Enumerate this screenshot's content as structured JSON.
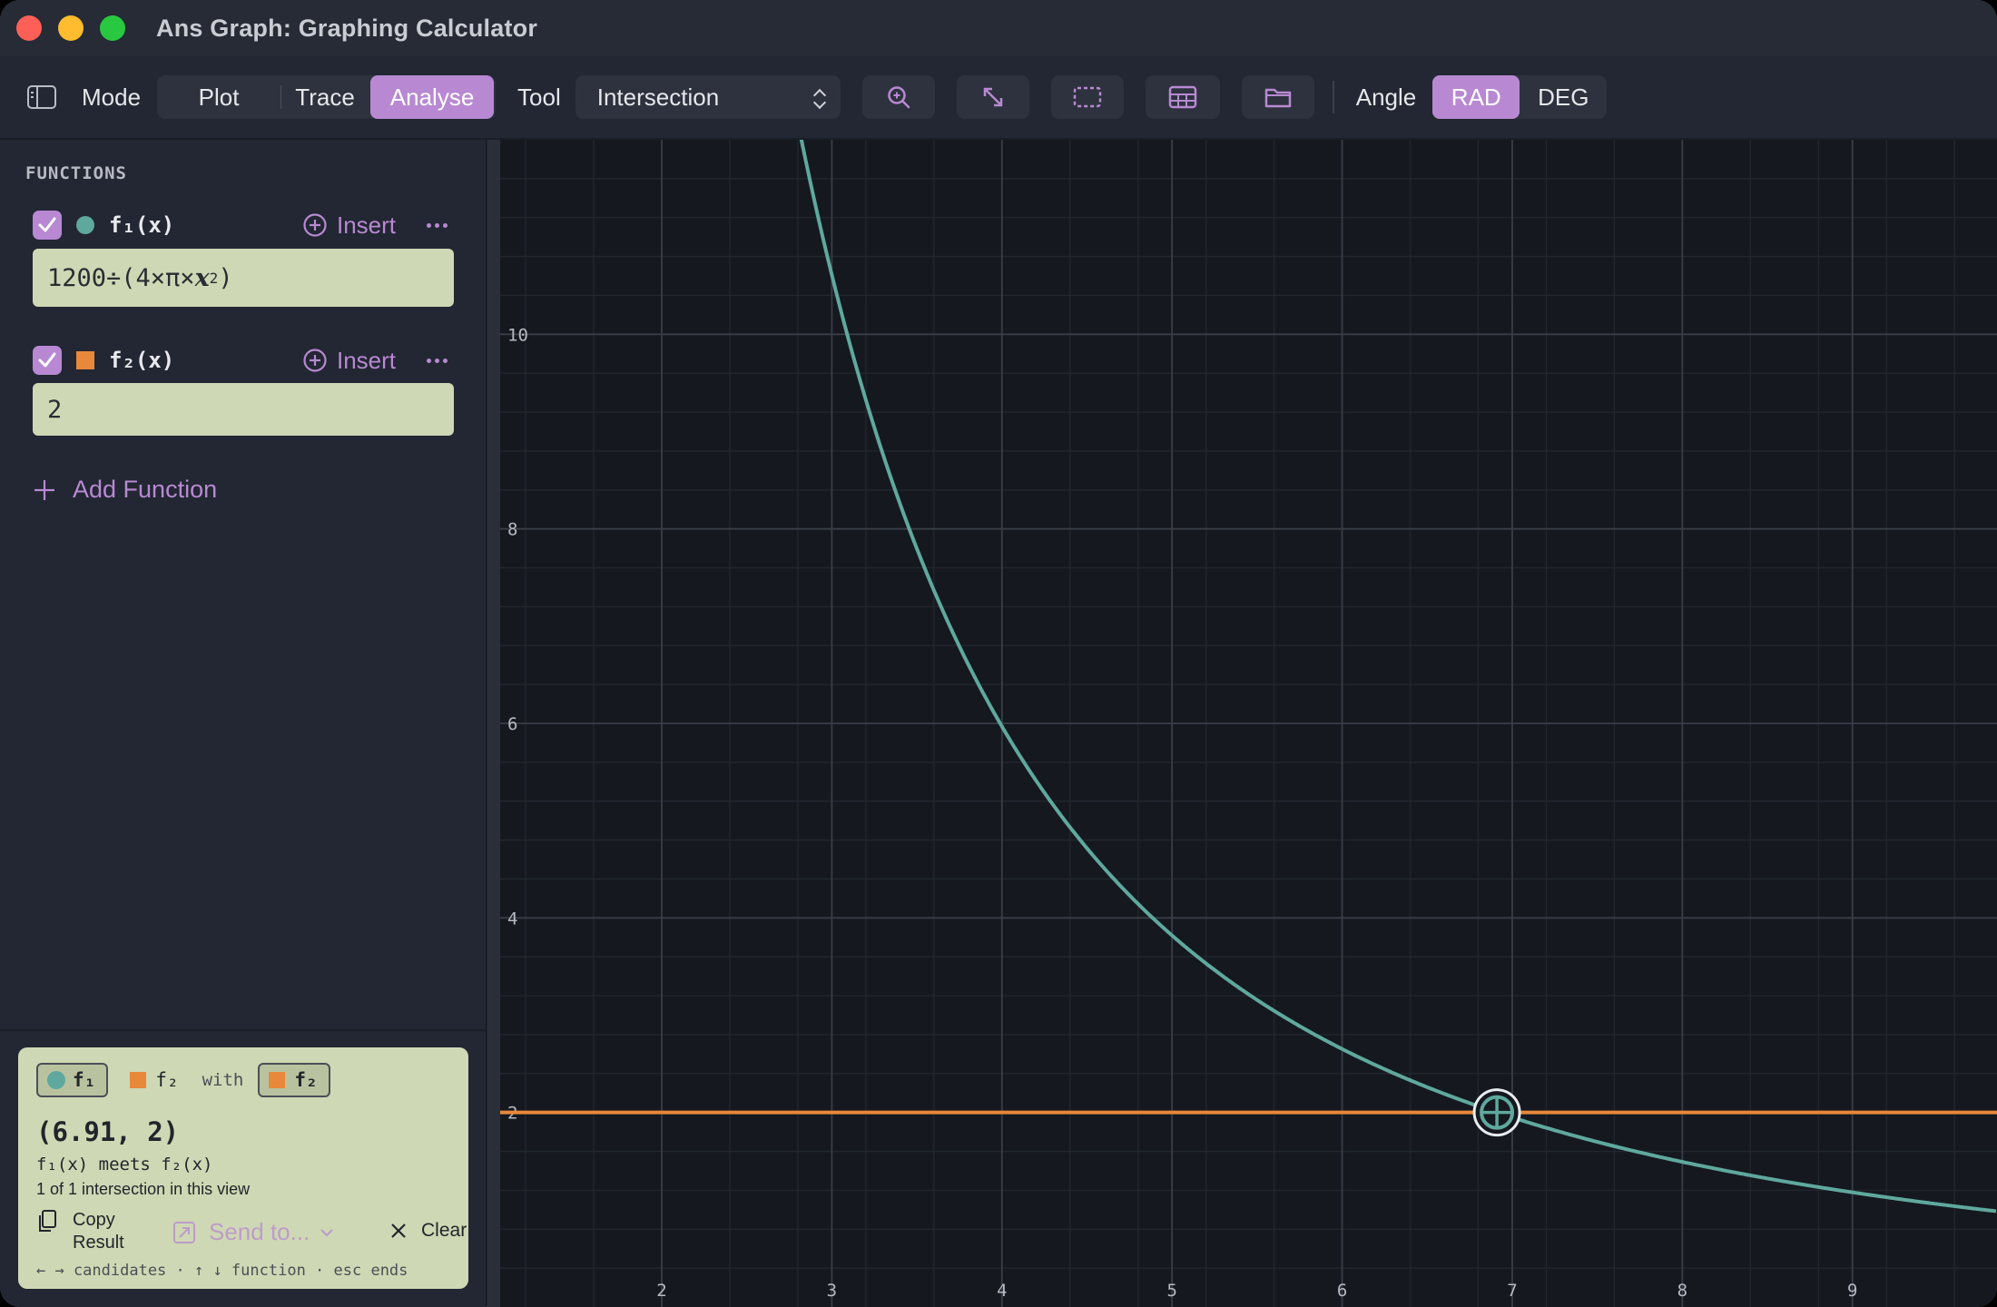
{
  "window": {
    "title": "Ans Graph: Graphing Calculator"
  },
  "toolbar": {
    "mode_label": "Mode",
    "modes": [
      "Plot",
      "Trace",
      "Analyse"
    ],
    "active_mode": "Analyse",
    "tool_label": "Tool",
    "tool_value": "Intersection",
    "angle_label": "Angle",
    "angles": [
      "RAD",
      "DEG"
    ],
    "active_angle": "RAD",
    "icons": [
      "sidebar-toggle-icon",
      "zoom-icon",
      "fit-view-icon",
      "select-region-icon",
      "table-icon",
      "folder-icon"
    ]
  },
  "sidebar": {
    "heading": "FUNCTIONS",
    "functions": [
      {
        "name": "f₁(x)",
        "expression_prefix": "1200÷(4×π×",
        "expression_var": "x",
        "expression_exp": "2",
        "expression_suffix": ")",
        "color": "#5fa89d",
        "marker": "circle",
        "enabled": true
      },
      {
        "name": "f₂(x)",
        "expression": "2",
        "color": "#e8883a",
        "marker": "square",
        "enabled": true
      }
    ],
    "insert_label": "Insert",
    "add_function_label": "Add Function"
  },
  "result": {
    "chip_primary": "f₁",
    "chip_secondary": "f₂",
    "with_label": "with",
    "chip_target": "f₂",
    "coordinate": "(6.91, 2)",
    "meets_text": "f₁(x) meets f₂(x)",
    "count_text": "1 of 1 intersection in this view",
    "copy_line1": "Copy",
    "copy_line2": "Result",
    "send_to_label": "Send to...",
    "clear_label": "Clear",
    "hint": "← → candidates · ↑ ↓ function · esc ends"
  },
  "chart_data": {
    "type": "line",
    "x_ticks": [
      2,
      3,
      4,
      5,
      6,
      7,
      8,
      9
    ],
    "y_ticks": [
      2,
      4,
      6,
      8,
      10
    ],
    "xlim": [
      1.05,
      9.85
    ],
    "ylim": [
      0.0,
      12.0
    ],
    "grid": true,
    "series": [
      {
        "expression": "1200/(4*pi*x^2)",
        "color": "#5fa89d"
      },
      {
        "expression": "2",
        "color": "#e8883a"
      }
    ],
    "intersection": {
      "x": 6.91,
      "y": 2
    },
    "colors": {
      "background": "#15181f",
      "grid_minor": "#22262f",
      "grid_major": "#383d47",
      "tick_label": "#b7bac2"
    }
  }
}
